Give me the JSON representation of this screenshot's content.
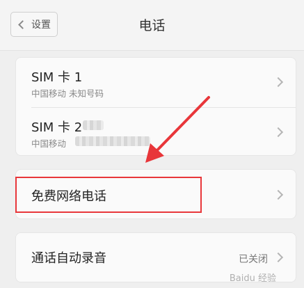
{
  "header": {
    "back_label": "设置",
    "title": "电话"
  },
  "sim_card": {
    "sim1": {
      "title": "SIM 卡 1",
      "subtitle": "中国移动 未知号码"
    },
    "sim2": {
      "title": "SIM 卡 2",
      "subtitle": "中国移动"
    }
  },
  "free_call": {
    "label": "免费网络电话"
  },
  "recording": {
    "label": "通话自动录音",
    "status": "已关闭"
  },
  "annotation": {
    "arrow_color": "#e8363a",
    "box_color": "#e8363a"
  },
  "watermark": {
    "text": "Baidu 经验"
  }
}
